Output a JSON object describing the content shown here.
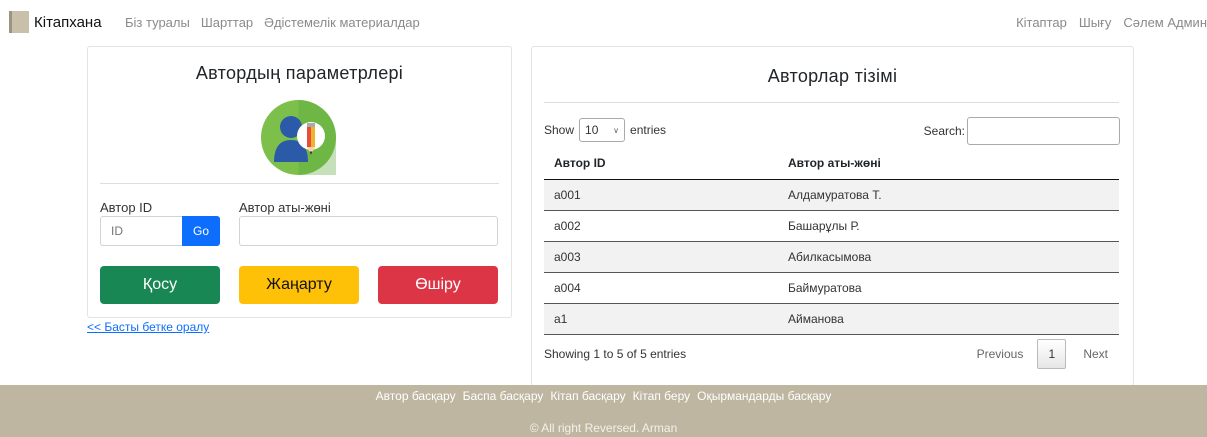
{
  "navbar": {
    "brand": "Кітапхана",
    "left_links": [
      "Біз туралы",
      "Шарттар",
      "Әдістемелік материалдар"
    ],
    "right_links": [
      "Кітаптар",
      "Шығу",
      "Сәлем Админ"
    ]
  },
  "form": {
    "title": "Автордың параметрлері",
    "id_label": "Автор ID",
    "id_placeholder": "ID",
    "go_label": "Go",
    "name_label": "Автор аты-жөні",
    "name_value": "",
    "add_label": "Қосу",
    "update_label": "Жаңарту",
    "delete_label": "Өшіру"
  },
  "back_link": "<< Басты бетке оралу",
  "authors": {
    "title": "Авторлар тізімі",
    "show_label": "Show",
    "page_length": "10",
    "entries_label": "entries",
    "search_label": "Search:",
    "columns": [
      "Автор ID",
      "Автор аты-жөні"
    ],
    "rows": [
      {
        "id": "a001",
        "name": "Алдамуратова Т."
      },
      {
        "id": "a002",
        "name": "Башарұлы Р."
      },
      {
        "id": "a003",
        "name": "Абилкасымова"
      },
      {
        "id": "a004",
        "name": "Баймуратова"
      },
      {
        "id": "a1",
        "name": "Айманова"
      }
    ],
    "info": "Showing 1 to 5 of 5 entries",
    "prev_label": "Previous",
    "page": "1",
    "next_label": "Next"
  },
  "footer": {
    "links": [
      "Автор басқару",
      "Баспа басқару",
      "Кітап басқару",
      "Кітап беру",
      "Оқырмандарды басқару"
    ],
    "copyright": "© All right Reversed. Arman"
  },
  "colors": {
    "primary": "#0d6efd",
    "success": "#198754",
    "warning": "#ffc107",
    "danger": "#dc3545",
    "footer_bg": "#bfb6a1"
  }
}
